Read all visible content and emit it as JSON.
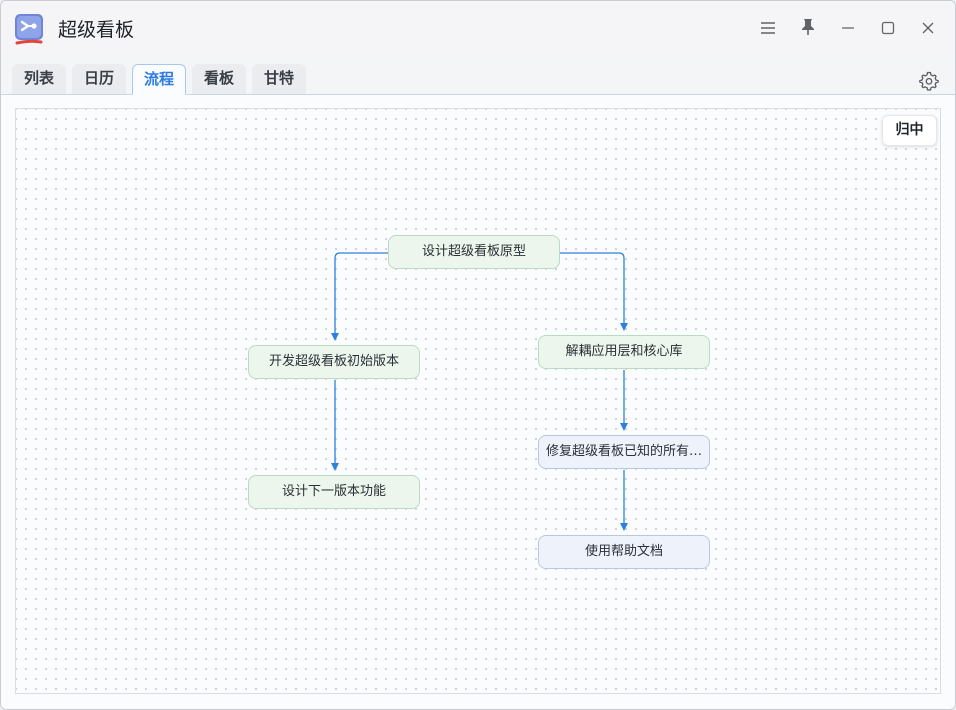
{
  "window": {
    "title": "超级看板",
    "icons": {
      "app": "kanban-app-icon",
      "menu": "menu-icon",
      "pin": "pin-icon",
      "minimize": "minimize-icon",
      "maximize": "maximize-icon",
      "close": "close-icon"
    }
  },
  "tabs": [
    {
      "label": "列表",
      "active": false
    },
    {
      "label": "日历",
      "active": false
    },
    {
      "label": "流程",
      "active": true
    },
    {
      "label": "看板",
      "active": false
    },
    {
      "label": "甘特",
      "active": false
    }
  ],
  "toolbar": {
    "settings_icon": "gear-icon"
  },
  "flow": {
    "center_button_label": "归中",
    "nodes": [
      {
        "id": "n1",
        "label": "设计超级看板原型",
        "style": "green"
      },
      {
        "id": "n2",
        "label": "开发超级看板初始版本",
        "style": "green"
      },
      {
        "id": "n3",
        "label": "解耦应用层和核心库",
        "style": "green"
      },
      {
        "id": "n4",
        "label": "设计下一版本功能",
        "style": "green"
      },
      {
        "id": "n5",
        "label": "修复超级看板已知的所有…",
        "style": "blue"
      },
      {
        "id": "n6",
        "label": "使用帮助文档",
        "style": "blue"
      }
    ],
    "edges": [
      {
        "from": "n1",
        "to": "n2"
      },
      {
        "from": "n1",
        "to": "n3"
      },
      {
        "from": "n2",
        "to": "n4"
      },
      {
        "from": "n3",
        "to": "n5"
      },
      {
        "from": "n5",
        "to": "n6"
      }
    ],
    "colors": {
      "edge": "#2f7fe0",
      "accent": "#2c7be5",
      "node_green_bg": "#edf6ec",
      "node_blue_bg": "#edf2fb"
    }
  }
}
